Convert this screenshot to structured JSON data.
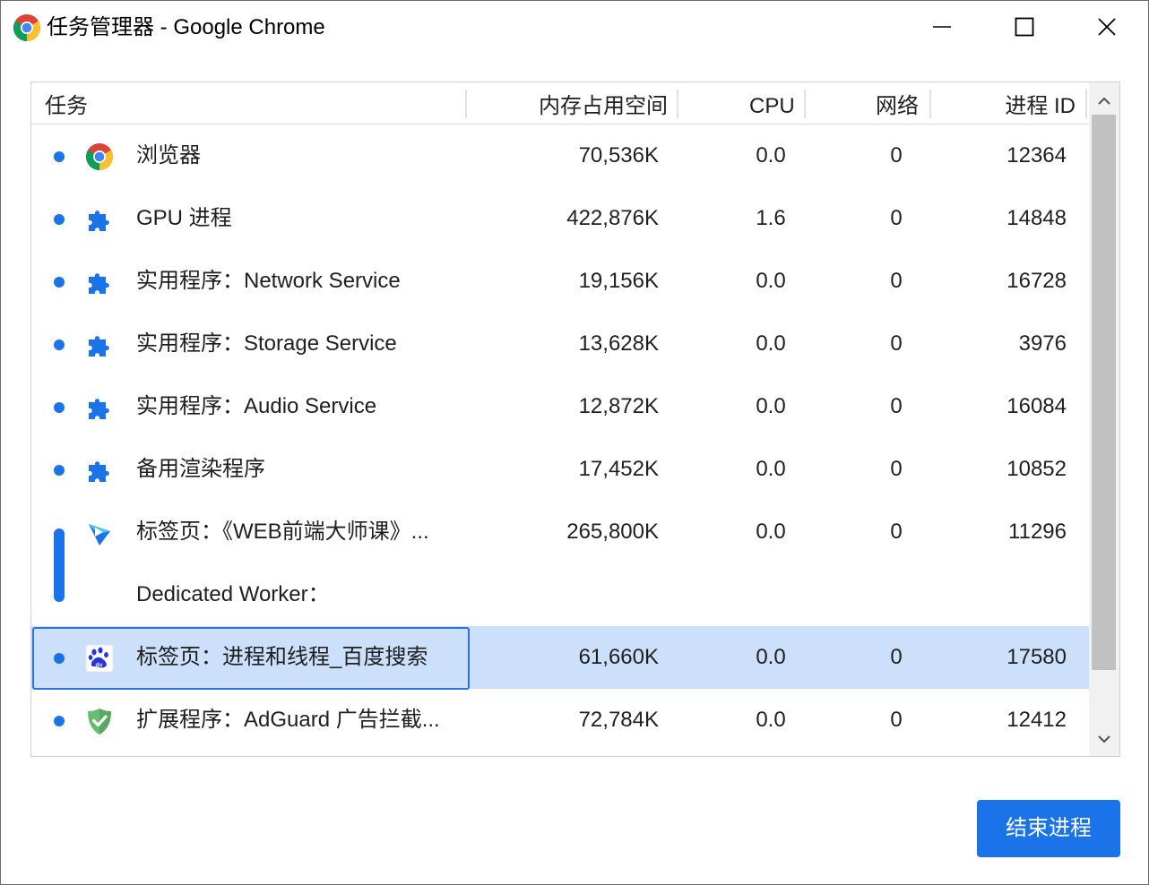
{
  "window": {
    "title": "任务管理器 - Google Chrome",
    "app_icon": "chrome-logo"
  },
  "window_controls": [
    "minimize-icon",
    "maximize-icon",
    "close-icon"
  ],
  "table": {
    "columns": {
      "task": "任务",
      "memory": "内存占用空间",
      "cpu": "CPU",
      "network": "网络",
      "pid": "进程 ID"
    },
    "rows": [
      {
        "icon": "chrome-icon",
        "name": "浏览器",
        "memory": "70,536K",
        "cpu": "0.0",
        "network": "0",
        "pid": "12364"
      },
      {
        "icon": "puzzle-icon",
        "name": "GPU 进程",
        "memory": "422,876K",
        "cpu": "1.6",
        "network": "0",
        "pid": "14848"
      },
      {
        "icon": "puzzle-icon",
        "name": "实用程序：Network Service",
        "memory": "19,156K",
        "cpu": "0.0",
        "network": "0",
        "pid": "16728"
      },
      {
        "icon": "puzzle-icon",
        "name": "实用程序：Storage Service",
        "memory": "13,628K",
        "cpu": "0.0",
        "network": "0",
        "pid": "3976"
      },
      {
        "icon": "puzzle-icon",
        "name": "实用程序：Audio Service",
        "memory": "12,872K",
        "cpu": "0.0",
        "network": "0",
        "pid": "16084"
      },
      {
        "icon": "puzzle-icon",
        "name": "备用渲染程序",
        "memory": "17,452K",
        "cpu": "0.0",
        "network": "0",
        "pid": "10852"
      },
      {
        "icon": "play-logo-icon",
        "name": "标签页：《WEB前端大师课》...",
        "memory": "265,800K",
        "cpu": "0.0",
        "network": "0",
        "pid": "11296"
      },
      {
        "icon": "",
        "name": "Dedicated Worker：",
        "memory": "",
        "cpu": "",
        "network": "",
        "pid": ""
      },
      {
        "icon": "baidu-paw-icon",
        "name": "标签页：进程和线程_百度搜索",
        "memory": "61,660K",
        "cpu": "0.0",
        "network": "0",
        "pid": "17580",
        "selected": true
      },
      {
        "icon": "shield-check-icon",
        "name": "扩展程序：AdGuard 广告拦截...",
        "memory": "72,784K",
        "cpu": "0.0",
        "network": "0",
        "pid": "12412"
      }
    ]
  },
  "end_process_button": "结束进程",
  "colors": {
    "accent": "#1a73e8",
    "selection": "#cce0fb",
    "selection_border": "#2a74de",
    "scrollbar_thumb": "#c1c1c1",
    "adguard_green": "#68bc71"
  }
}
